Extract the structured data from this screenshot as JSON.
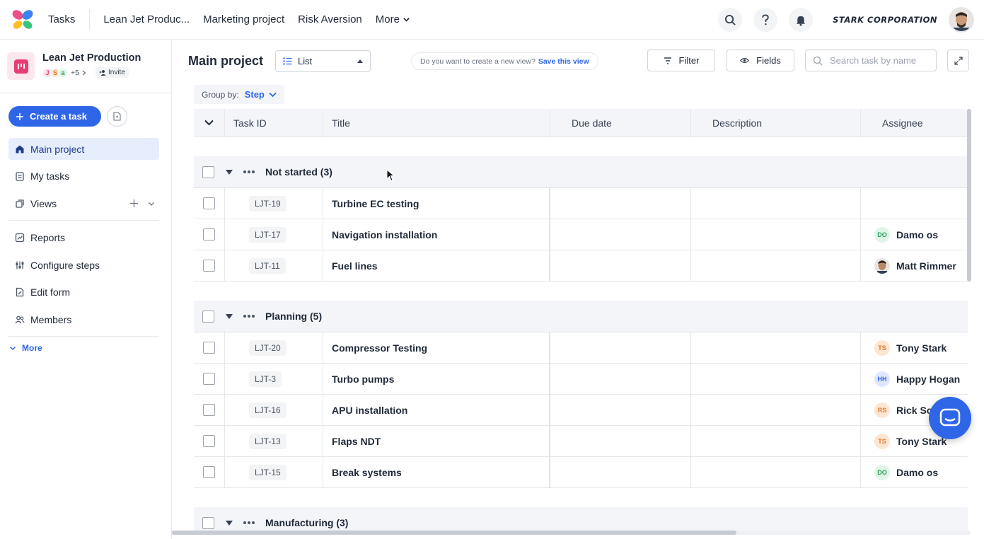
{
  "topbar": {
    "tasks_label": "Tasks",
    "nav": [
      "Lean Jet Produc...",
      "Marketing project",
      "Risk Aversion"
    ],
    "more_label": "More",
    "brand": "STARK CORPORATION"
  },
  "sidebar": {
    "project_name": "Lean Jet Production",
    "members": [
      "J",
      "S",
      "a"
    ],
    "extra_members": "+5",
    "invite_label": "Invite",
    "create_label": "Create a task",
    "items": [
      {
        "label": "Main project",
        "icon": "home-icon"
      },
      {
        "label": "My tasks",
        "icon": "clipboard-icon"
      },
      {
        "label": "Views",
        "icon": "views-icon"
      },
      {
        "label": "Reports",
        "icon": "chart-icon"
      },
      {
        "label": "Configure steps",
        "icon": "steps-icon"
      },
      {
        "label": "Edit form",
        "icon": "form-icon"
      },
      {
        "label": "Members",
        "icon": "members-icon"
      }
    ],
    "more_label": "More"
  },
  "toolbar": {
    "title": "Main project",
    "view_label": "List",
    "save_prompt": "Do you want to create a new view?",
    "save_link": "Save this view",
    "filter_label": "Filter",
    "fields_label": "Fields",
    "search_placeholder": "Search task by name"
  },
  "groupby": {
    "label": "Group by:",
    "value": "Step"
  },
  "table": {
    "headers": {
      "id": "Task ID",
      "title": "Title",
      "due": "Due date",
      "desc": "Description",
      "assignee": "Assignee"
    },
    "groups": [
      {
        "label": "Not started (3)",
        "rows": [
          {
            "id": "LJT-19",
            "title": "Turbine EC testing",
            "assignee": "",
            "initials": "",
            "color": ""
          },
          {
            "id": "LJT-17",
            "title": "Navigation installation",
            "assignee": "Damo os",
            "initials": "DO",
            "color": "green"
          },
          {
            "id": "LJT-11",
            "title": "Fuel lines",
            "assignee": "Matt Rimmer",
            "initials": "",
            "color": "photo"
          }
        ]
      },
      {
        "label": "Planning (5)",
        "rows": [
          {
            "id": "LJT-20",
            "title": "Compressor Testing",
            "assignee": "Tony Stark",
            "initials": "TS",
            "color": "orange"
          },
          {
            "id": "LJT-3",
            "title": "Turbo pumps",
            "assignee": "Happy Hogan",
            "initials": "HH",
            "color": "blue"
          },
          {
            "id": "LJT-16",
            "title": "APU installation",
            "assignee": "Rick Sc",
            "initials": "RS",
            "color": "orange"
          },
          {
            "id": "LJT-13",
            "title": "Flaps NDT",
            "assignee": "Tony Stark",
            "initials": "TS",
            "color": "orange"
          },
          {
            "id": "LJT-15",
            "title": "Break systems",
            "assignee": "Damo os",
            "initials": "DO",
            "color": "green"
          }
        ]
      },
      {
        "label": "Manufacturing (3)",
        "rows": []
      }
    ]
  },
  "colors": {
    "accent": "#2f66e8",
    "green_bg": "#dff5e8",
    "green_fg": "#2f9e5e",
    "orange_bg": "#fde6d2",
    "orange_fg": "#e07b2c",
    "blue_bg": "#dfe7fd",
    "blue_fg": "#2f66e8"
  }
}
